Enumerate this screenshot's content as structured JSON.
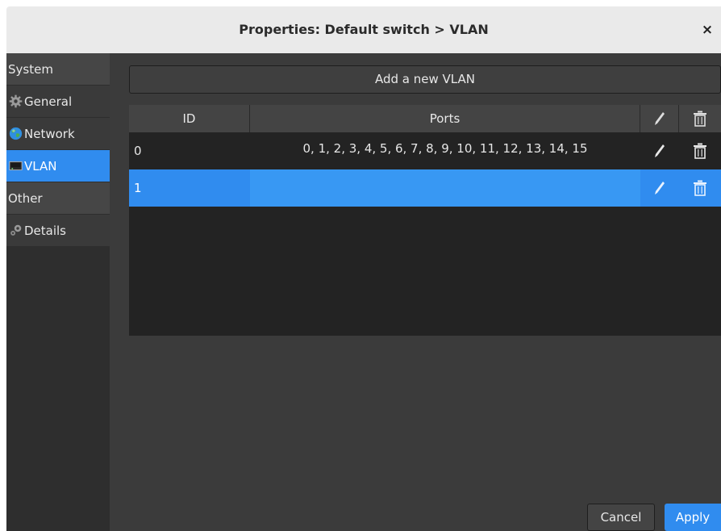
{
  "window": {
    "title": "Properties: Default switch > VLAN",
    "close_label": "×"
  },
  "sidebar": {
    "sections": [
      {
        "header": "System",
        "items": [
          {
            "label": "General",
            "icon": "gear-icon"
          },
          {
            "label": "Network",
            "icon": "globe-icon"
          },
          {
            "label": "VLAN",
            "icon": "switch-icon",
            "active": true
          }
        ]
      },
      {
        "header": "Other",
        "items": [
          {
            "label": "Details",
            "icon": "gears-icon"
          }
        ]
      }
    ]
  },
  "main": {
    "add_button": "Add a new VLAN",
    "table": {
      "columns": [
        "ID",
        "Ports"
      ],
      "column_icons": [
        "edit-icon",
        "trash-icon"
      ],
      "rows": [
        {
          "id": "0",
          "ports": "0, 1, 2, 3, 4, 5, 6, 7, 8, 9, 10, 11, 12, 13, 14, 15",
          "selected": false
        },
        {
          "id": "1",
          "ports": "",
          "selected": true
        }
      ]
    }
  },
  "footer": {
    "cancel_label": "Cancel",
    "apply_label": "Apply"
  },
  "colors": {
    "accent": "#308cef",
    "panel": "#3b3b3b",
    "table_bg": "#232323"
  }
}
